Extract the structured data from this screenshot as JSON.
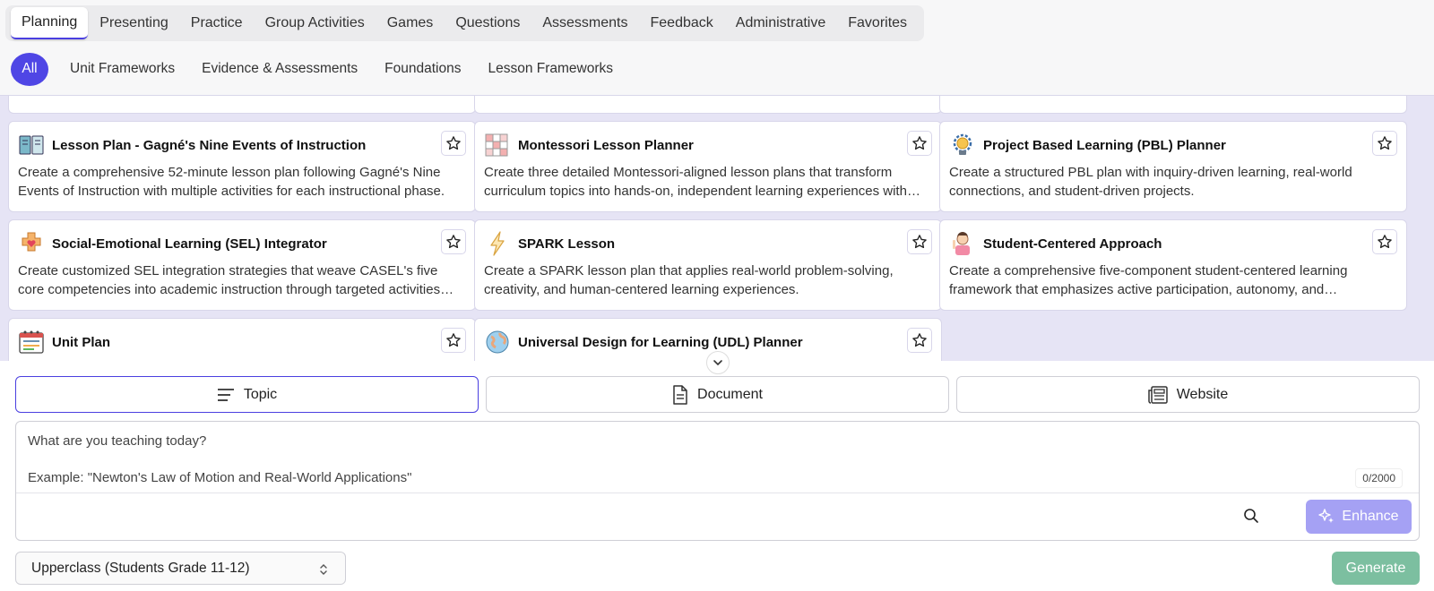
{
  "categories": [
    "Planning",
    "Presenting",
    "Practice",
    "Group Activities",
    "Games",
    "Questions",
    "Assessments",
    "Feedback",
    "Administrative",
    "Favorites"
  ],
  "filters": [
    "All",
    "Unit Frameworks",
    "Evidence & Assessments",
    "Foundations",
    "Lesson Frameworks"
  ],
  "cards": [
    {
      "title": "Lesson Plan - Gagné's Nine Events of Instruction",
      "desc": "Create a comprehensive 52-minute lesson plan following Gagné's Nine Events of Instruction with multiple activities for each instructional phase.",
      "icon": "book-icon"
    },
    {
      "title": "Montessori Lesson Planner",
      "desc": "Create three detailed Montessori-aligned lesson plans that transform curriculum topics into hands-on, independent learning experiences with guided materials.",
      "icon": "grid-blocks-icon"
    },
    {
      "title": "Project Based Learning (PBL) Planner",
      "desc": "Create a structured PBL plan with inquiry-driven learning, real-world connections, and student-driven projects.",
      "icon": "lightbulb-icon"
    },
    {
      "title": "Social-Emotional Learning (SEL) Integrator",
      "desc": "Create customized SEL integration strategies that weave CASEL's five core competencies into academic instruction through targeted activities and reflection.",
      "icon": "heart-puzzle-icon"
    },
    {
      "title": "SPARK Lesson",
      "desc": "Create a SPARK lesson plan that applies real-world problem-solving, creativity, and human-centered learning experiences.",
      "icon": "lightning-icon"
    },
    {
      "title": "Student-Centered Approach",
      "desc": "Create a comprehensive five-component student-centered learning framework that emphasizes active participation, autonomy, and collaboration.",
      "icon": "student-icon"
    },
    {
      "title": "Unit Plan",
      "desc": "",
      "icon": "calendar-book-icon"
    },
    {
      "title": "Universal Design for Learning (UDL) Planner",
      "desc": "",
      "icon": "globe-icon"
    }
  ],
  "source": {
    "topic": "Topic",
    "document": "Document",
    "website": "Website"
  },
  "input": {
    "line1": "What are you teaching today?",
    "line2": "Example: \"Newton's Law of Motion and Real-World Applications\"",
    "counter": "0/2000"
  },
  "enhance_label": "Enhance",
  "grade_value": "Upperclass (Students Grade 11-12)",
  "generate_label": "Generate",
  "colors": {
    "accent": "#4f46e5",
    "enhance": "#a5a1f4",
    "generate": "#7cbfa0"
  }
}
